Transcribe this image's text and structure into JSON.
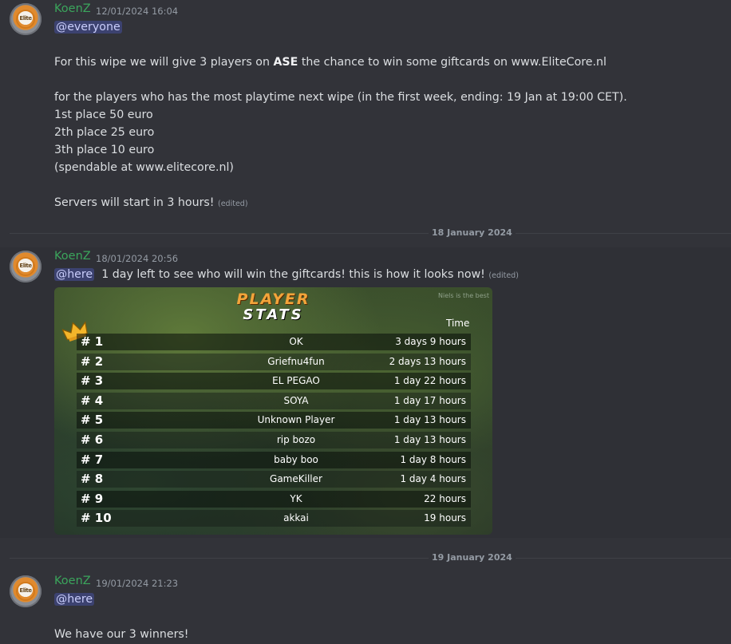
{
  "messages": [
    {
      "author": "KoenZ",
      "timestamp": "12/01/2024 16:04",
      "mention": "@everyone",
      "line1_pre": "For this wipe we will give 3 players on ",
      "line1_bold": "ASE",
      "line1_post": " the chance to win some giftcards on www.EliteCore.nl",
      "line2": "for the players who has the most playtime next wipe (in the first week, ending: 19 Jan at 19:00 CET).",
      "line3": "1st place 50 euro",
      "line4": "2th place 25 euro",
      "line5": "3th place 10 euro",
      "line6": "(spendable at www.elitecore.nl)",
      "line7": "Servers will start in 3 hours!",
      "edited": "(edited)"
    },
    {
      "author": "KoenZ",
      "timestamp": "18/01/2024 20:56",
      "mention": "@here",
      "text": "1 day left to see who will win the giftcards!   this is how it looks now!",
      "edited": "(edited)"
    },
    {
      "author": "KoenZ",
      "timestamp": "19/01/2024 21:23",
      "mention": "@here",
      "text": "We have our 3 winners!"
    }
  ],
  "dividers": [
    "18 January 2024",
    "19 January 2024"
  ],
  "avatar_text": "Elite",
  "stats_image": {
    "title_line1": "PLAYER",
    "title_line2": "STATS",
    "watermark": "Niels is the best",
    "time_header": "Time",
    "rows": [
      {
        "rank": "# 1",
        "name": "OK",
        "time": "3 days 9 hours"
      },
      {
        "rank": "# 2",
        "name": "Griefnu4fun",
        "time": "2 days 13 hours"
      },
      {
        "rank": "# 3",
        "name": "EL PEGAO",
        "time": "1 day 22 hours"
      },
      {
        "rank": "# 4",
        "name": "SOYA",
        "time": "1 day 17 hours"
      },
      {
        "rank": "# 5",
        "name": "Unknown Player",
        "time": "1 day 13 hours"
      },
      {
        "rank": "# 6",
        "name": "rip bozo",
        "time": "1 day 13 hours"
      },
      {
        "rank": "# 7",
        "name": "baby boo",
        "time": "1 day 8 hours"
      },
      {
        "rank": "# 8",
        "name": "GameKiller",
        "time": "1 day 4 hours"
      },
      {
        "rank": "# 9",
        "name": "YK",
        "time": "22 hours"
      },
      {
        "rank": "# 10",
        "name": "akkai",
        "time": "19 hours"
      }
    ]
  },
  "colors": {
    "background": "#323339",
    "author": "#3ba55c",
    "mention_bg": "#3c4270",
    "mention_text": "#c9cdfb",
    "stats_title": "#f3a43a"
  }
}
